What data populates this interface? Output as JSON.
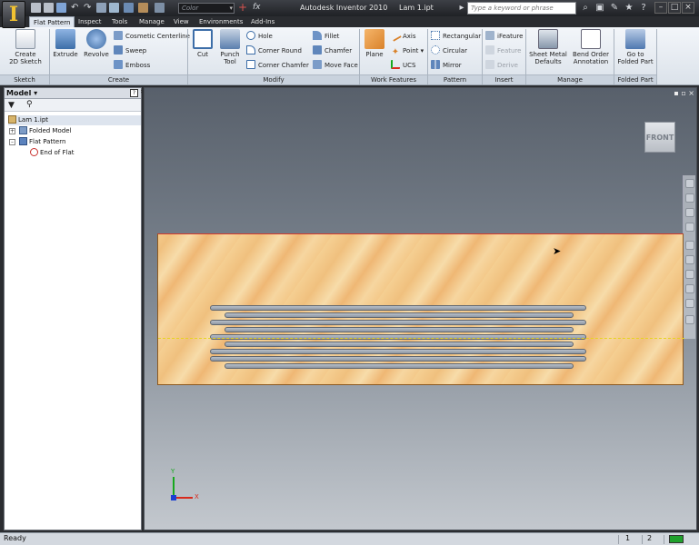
{
  "titlebar": {
    "app_logo": "I",
    "app_name": "Autodesk Inventor 2010",
    "document": "Lam 1.ipt",
    "color_placeholder": "Color",
    "search_placeholder": "Type a keyword or phrase"
  },
  "tabs": [
    "Flat Pattern",
    "Inspect",
    "Tools",
    "Manage",
    "View",
    "Environments",
    "Add-Ins"
  ],
  "ribbon": {
    "panels": [
      "Sketch",
      "Create",
      "Modify",
      "Work Features",
      "Pattern",
      "Insert",
      "Manage",
      "Folded Part"
    ],
    "sketch": {
      "create_2d_sketch_l1": "Create",
      "create_2d_sketch_l2": "2D Sketch"
    },
    "create": {
      "extrude": "Extrude",
      "revolve": "Revolve",
      "cosmetic_centerline": "Cosmetic Centerline",
      "sweep": "Sweep",
      "emboss": "Emboss"
    },
    "modify": {
      "cut": "Cut",
      "punch_l1": "Punch",
      "punch_l2": "Tool",
      "hole": "Hole",
      "corner_round": "Corner Round",
      "corner_chamfer": "Corner Chamfer",
      "fillet": "Fillet",
      "chamfer": "Chamfer",
      "move_face": "Move Face"
    },
    "work_features": {
      "plane": "Plane",
      "axis": "Axis",
      "point": "Point",
      "ucs": "UCS"
    },
    "pattern": {
      "rectangular": "Rectangular",
      "circular": "Circular",
      "mirror": "Mirror"
    },
    "insert": {
      "ifeature": "iFeature",
      "feature": "Feature",
      "derive": "Derive"
    },
    "manage": {
      "sheet_metal_l1": "Sheet Metal",
      "sheet_metal_l2": "Defaults",
      "bend_order_l1": "Bend Order",
      "bend_order_l2": "Annotation"
    },
    "folded": {
      "go_to_l1": "Go to",
      "go_to_l2": "Folded Part"
    }
  },
  "browser": {
    "title": "Model",
    "help": "?",
    "close": "×",
    "tree": [
      "Lam 1.ipt",
      "Folded Model",
      "Flat Pattern",
      "End of Flat"
    ]
  },
  "viewport": {
    "viewcube_label": "FRONT",
    "triad_x": "X",
    "triad_y": "Y"
  },
  "statusbar": {
    "text": "Ready",
    "num1": "1",
    "num2": "2"
  },
  "colors": {
    "accent": "#f1c232",
    "part_wood": "#f4c98a",
    "slot": "#8e97a2",
    "centerline": "#e7d420"
  }
}
